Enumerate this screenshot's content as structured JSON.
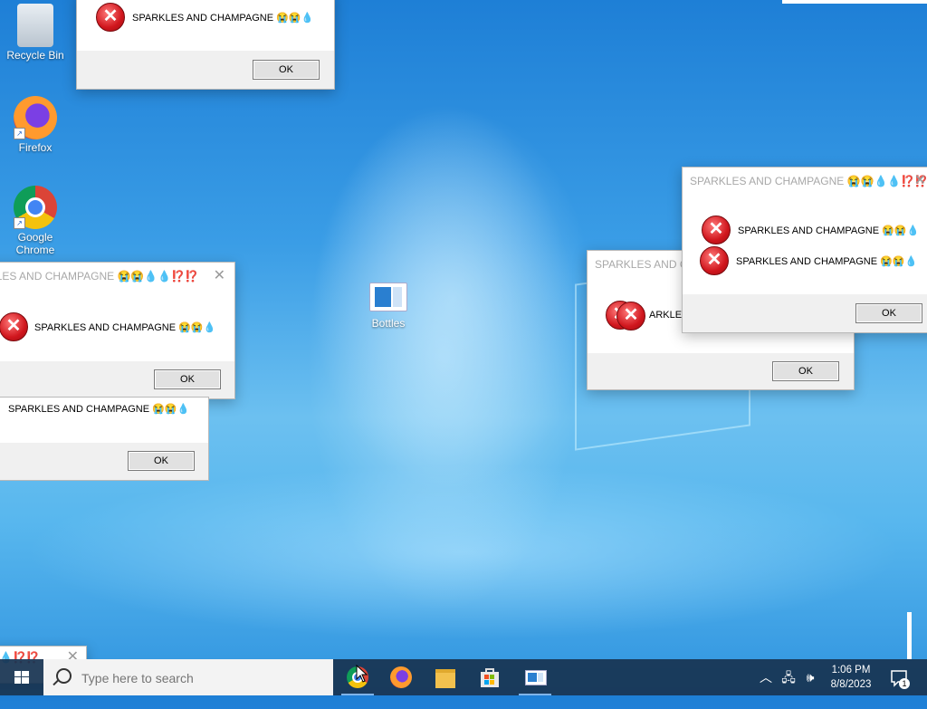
{
  "desktop": {
    "icons": [
      {
        "label": "Recycle Bin"
      },
      {
        "label": "Firefox"
      },
      {
        "label": "Google Chrome"
      },
      {
        "label": "Bottles"
      }
    ]
  },
  "dialogs": [
    {
      "title": "",
      "message": "SPARKLES AND CHAMPAGNE 😭😭💧",
      "ok": "OK"
    },
    {
      "title": "RKLES AND CHAMPAGNE 😭😭💧💧⁉️⁉️",
      "message": "SPARKLES AND CHAMPAGNE 😭😭💧",
      "ok": "OK"
    },
    {
      "title": "",
      "message": "SPARKLES AND CHAMPAGNE 😭😭💧",
      "ok": "OK"
    },
    {
      "title": "SPARKLES AND CHA",
      "message": "ARKLES AND C",
      "ok": "OK"
    },
    {
      "title": "SPARKLES AND CHAMPAGNE 😭😭💧💧⁉️⁉️",
      "message": "SPARKLES AND CHAMPAGNE 😭😭💧",
      "message2": "SPARKLES AND CHAMPAGNE 😭😭💧",
      "ok": "OK"
    },
    {
      "title": "💧⁉️⁉️"
    }
  ],
  "taskbar": {
    "search_placeholder": "Type here to search",
    "apps": [
      "chrome-icon",
      "firefox-icon",
      "file-explorer-icon",
      "store-icon",
      "bottles-icon"
    ],
    "clock_time": "1:06 PM",
    "clock_date": "8/8/2023",
    "notification_count": "1"
  }
}
